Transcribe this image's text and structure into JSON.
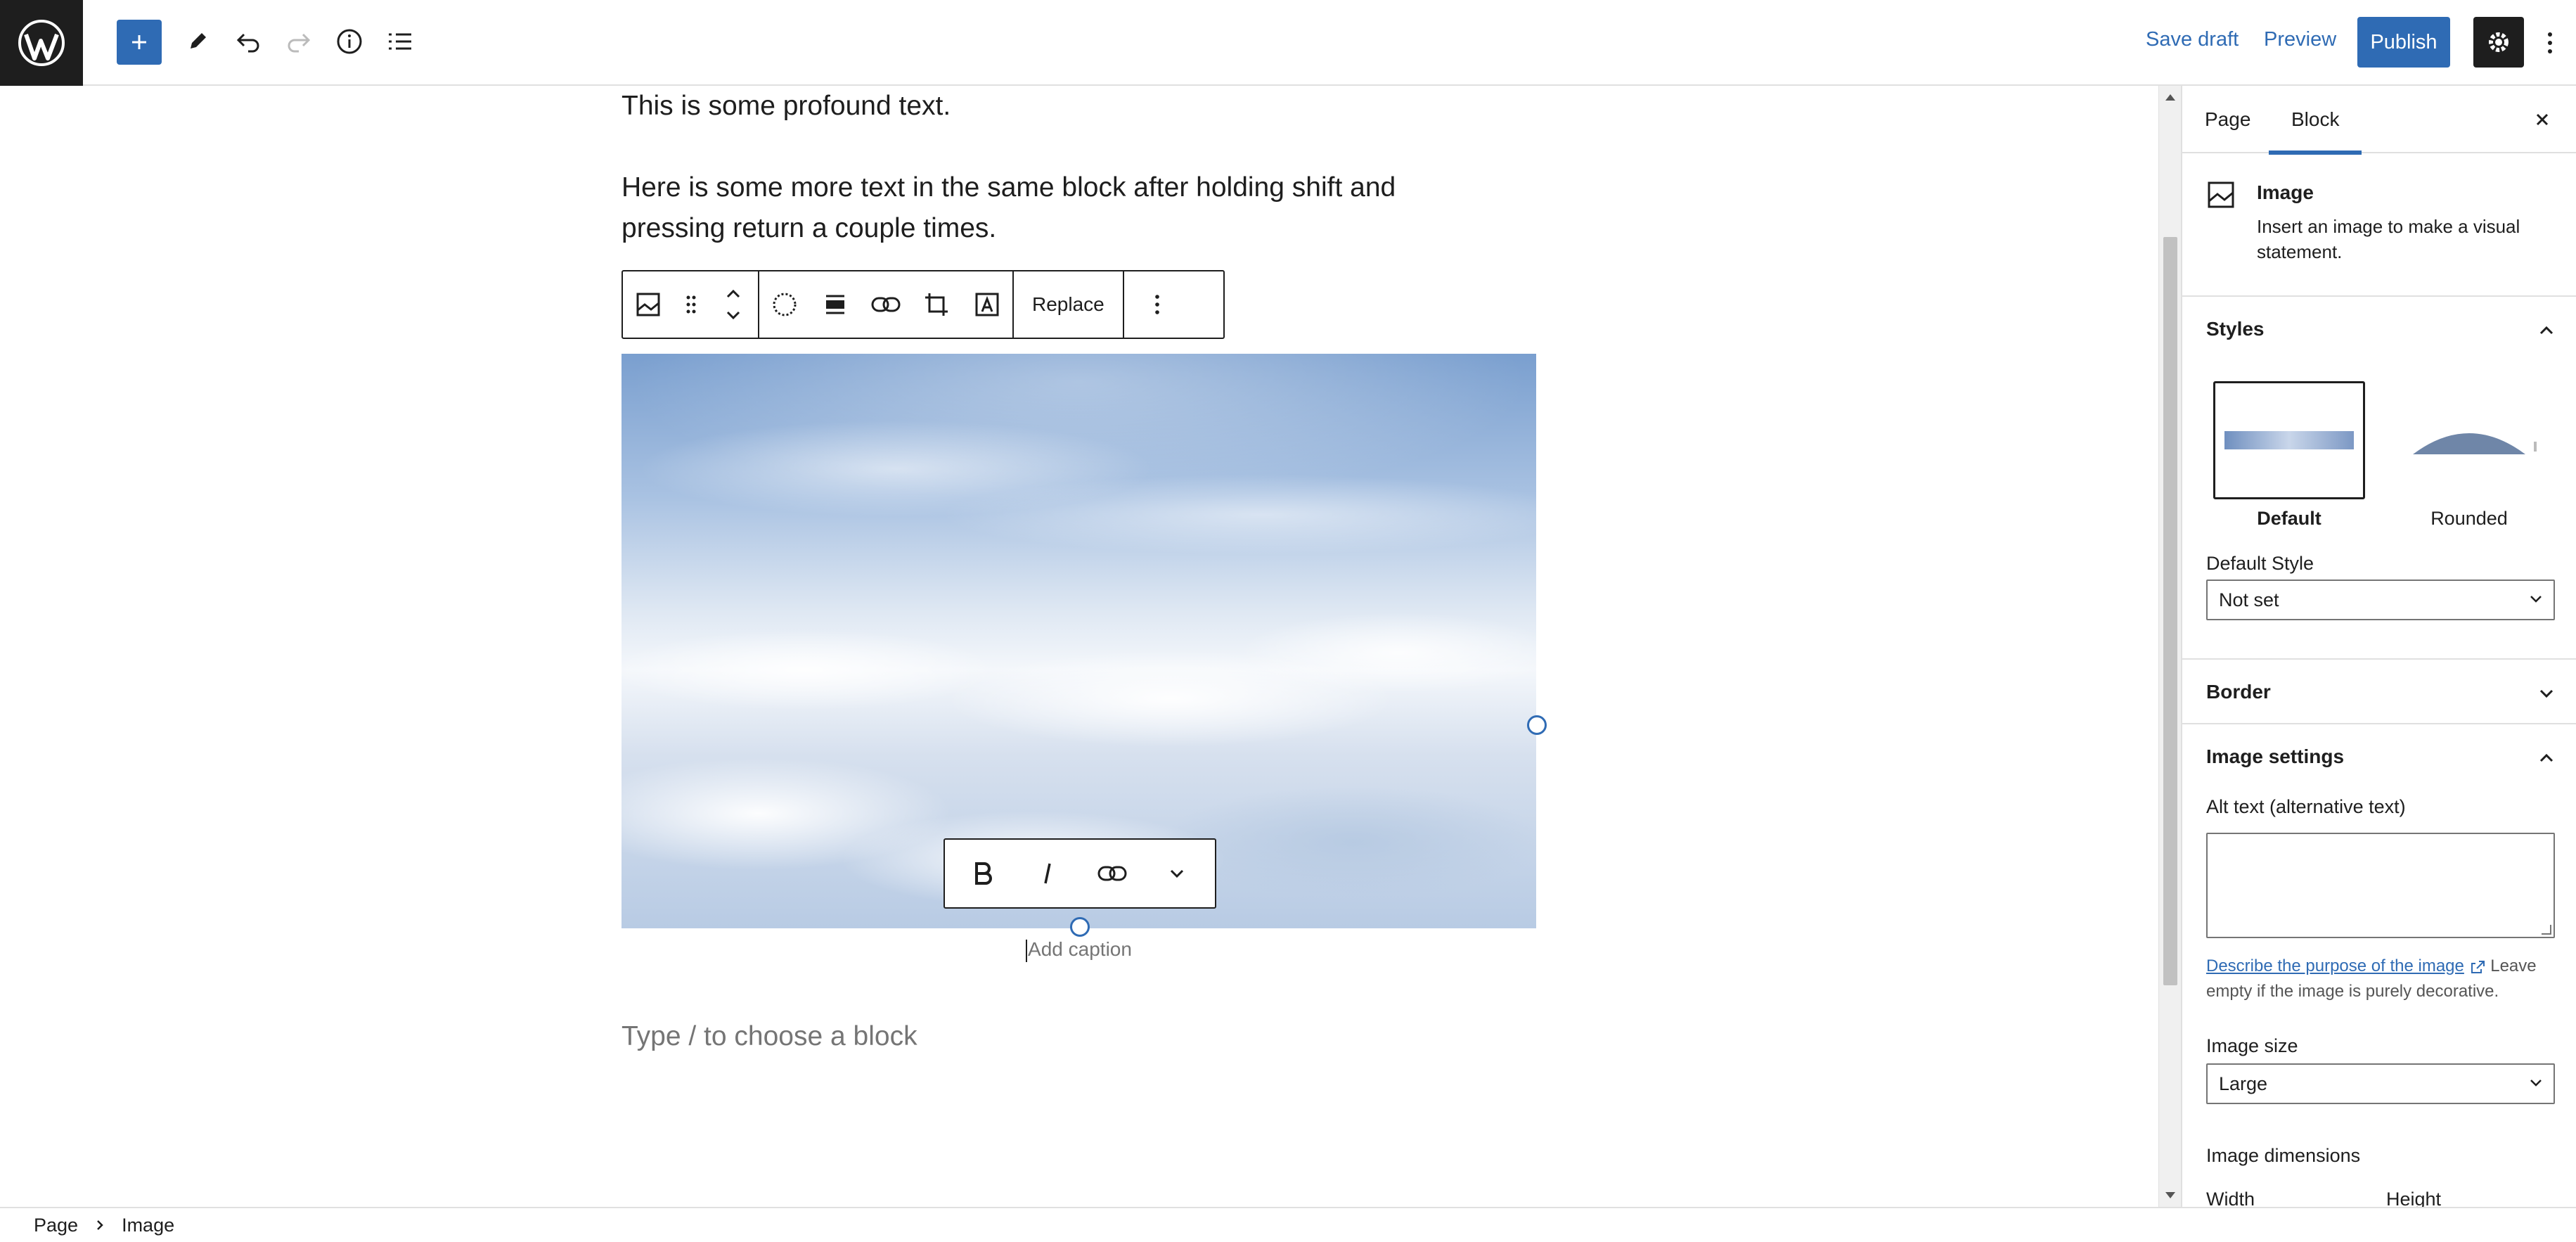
{
  "topbar": {
    "save_draft": "Save draft",
    "preview": "Preview",
    "publish": "Publish"
  },
  "icons": {
    "logo": "wordpress-logo-icon",
    "add": "plus-icon",
    "tools": "pencil-icon",
    "undo": "undo-icon",
    "redo": "redo-icon",
    "details": "info-icon",
    "list_view": "list-view-icon",
    "settings": "gear-icon",
    "options": "more-vertical-icon"
  },
  "content": {
    "paragraph1": "This is some profound text.",
    "paragraph2": "Here is some more text in the same block after holding shift and pressing return a couple times.",
    "block_toolbar": {
      "replace_label": "Replace"
    },
    "caption_placeholder": "Add caption",
    "block_placeholder": "Type / to choose a block"
  },
  "sidebar": {
    "tabs": [
      {
        "label": "Page",
        "active": false
      },
      {
        "label": "Block",
        "active": true
      }
    ],
    "block_card": {
      "title": "Image",
      "description": "Insert an image to make a visual statement."
    },
    "styles": {
      "title": "Styles",
      "options": [
        {
          "label": "Default",
          "selected": true
        },
        {
          "label": "Rounded",
          "selected": false
        }
      ],
      "default_style_label": "Default Style",
      "default_style_value": "Not set"
    },
    "border": {
      "title": "Border"
    },
    "image_settings": {
      "title": "Image settings",
      "alt_label": "Alt text (alternative text)",
      "alt_value": "",
      "describe_link": "Describe the purpose of the image",
      "describe_rest": "Leave empty if the image is purely decorative.",
      "size_label": "Image size",
      "size_value": "Large",
      "dimensions_label": "Image dimensions",
      "width_label": "Width",
      "height_label": "Height"
    }
  },
  "footer": {
    "breadcrumbs": [
      "Page",
      "Image"
    ]
  },
  "colors": {
    "accent": "#2f6bb4",
    "dark": "#1e1e1e",
    "muted": "#757575"
  }
}
